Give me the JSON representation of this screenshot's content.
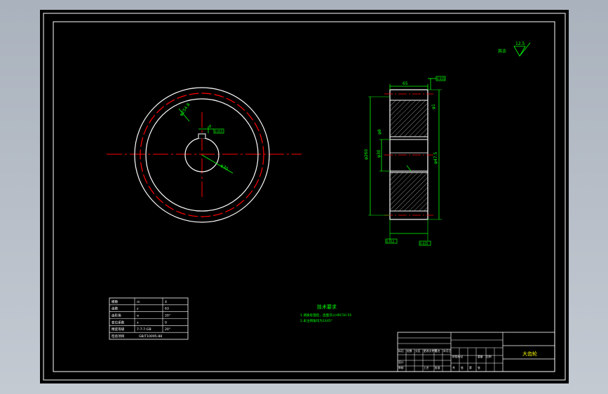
{
  "colors": {
    "canvas": "#000000",
    "outline": "#ffffff",
    "dimension": "#00ff00",
    "center_line": "#ff0000",
    "hatch": "#b0b0b0",
    "annotation": "#00ff00",
    "title_accent": "#ffff00"
  },
  "drawing": {
    "front_view": {
      "pitch_label": "φ254.8",
      "keyway_label": "8",
      "keyway_box": "0.015",
      "bore_label": "φ30"
    },
    "side_view": {
      "top_width": "65",
      "right_callout": "0.025",
      "right_label_top": "φ1",
      "right_label_mid": "φ47.5",
      "left_label_outer": "φ260",
      "left_label_inner": "φ30",
      "left_label_hub": "φ8",
      "bottom_box_left": "0.012",
      "bottom_box_right": "0.025"
    },
    "roughness_note": {
      "label": "其余",
      "value": "12.5"
    },
    "technical_requirements": {
      "title": "技术要求",
      "line1": "1.调质处理后，齿面淬火HRC50-55",
      "line2": "2.未注倒角均为1X45°"
    }
  },
  "param_table": {
    "rows": [
      [
        "模数",
        "m",
        "4"
      ],
      [
        "齿数",
        "z",
        "63"
      ],
      [
        "齿形角",
        "α",
        "20°"
      ],
      [
        "变位系数",
        "x",
        "0"
      ],
      [
        "精度等级",
        "7-7-7-GB",
        "20°"
      ],
      [
        "检验项目",
        "GB/T10095-88",
        ""
      ]
    ]
  },
  "title_block": {
    "part_name": "大齿轮",
    "cells": [
      "标记",
      "处数",
      "分区",
      "更改文件号",
      "签名",
      "年月日",
      "设计",
      "审核",
      "工艺",
      "批准",
      "阶段标记",
      "重量",
      "比例",
      "共",
      "张",
      "第",
      "张"
    ]
  }
}
